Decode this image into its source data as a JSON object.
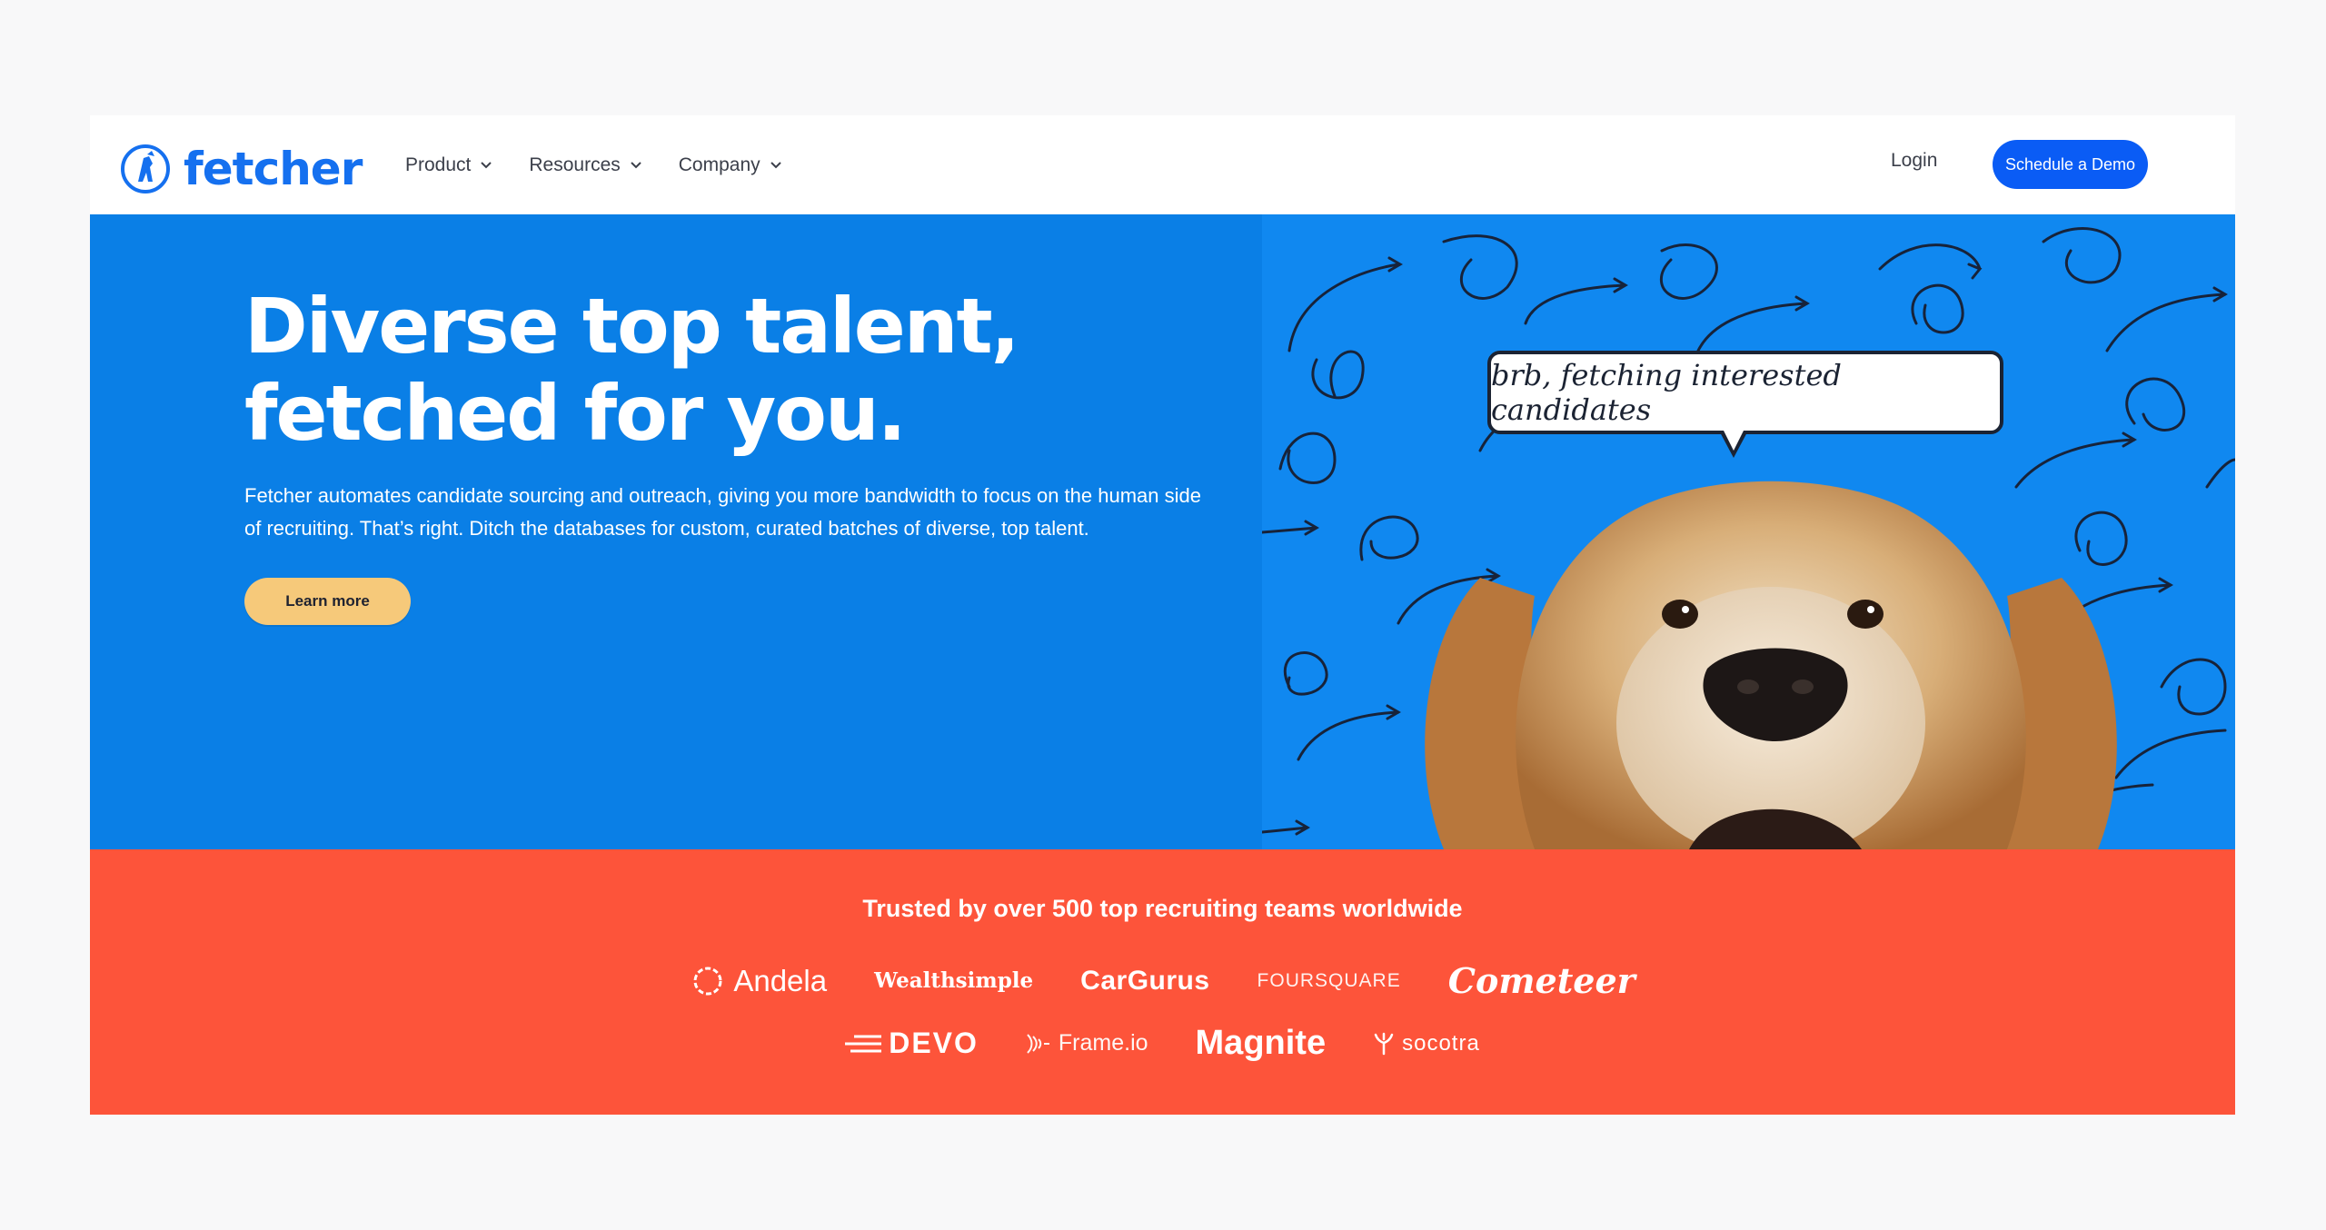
{
  "header": {
    "brand": "fetcher",
    "nav": [
      {
        "label": "Product"
      },
      {
        "label": "Resources"
      },
      {
        "label": "Company"
      }
    ],
    "login_label": "Login",
    "demo_label": "Schedule a Demo"
  },
  "hero": {
    "title": "Diverse top talent, fetched for you.",
    "body": "Fetcher automates candidate sourcing and outreach, giving you more bandwidth to focus on the human side of recruiting. That’s right. Ditch the databases for custom, curated batches of diverse, top talent.",
    "cta_label": "Learn more",
    "bubble_text": "brb, fetching interested candidates"
  },
  "trust": {
    "title": "Trusted by over 500 top recruiting teams worldwide",
    "logos_row1": [
      "Andela",
      "Wealthsimple",
      "CarGurus",
      "FOURSQUARE",
      "Cometeer"
    ],
    "logos_row2": [
      "DEVO",
      "Frame.io",
      "Magnite",
      "socotra"
    ]
  },
  "colors": {
    "brand_blue": "#1570ef",
    "hero_blue": "#0a7fe6",
    "cta_yellow": "#f6c97a",
    "trust_red": "#fd543a",
    "demo_button": "#0a5cf5"
  }
}
